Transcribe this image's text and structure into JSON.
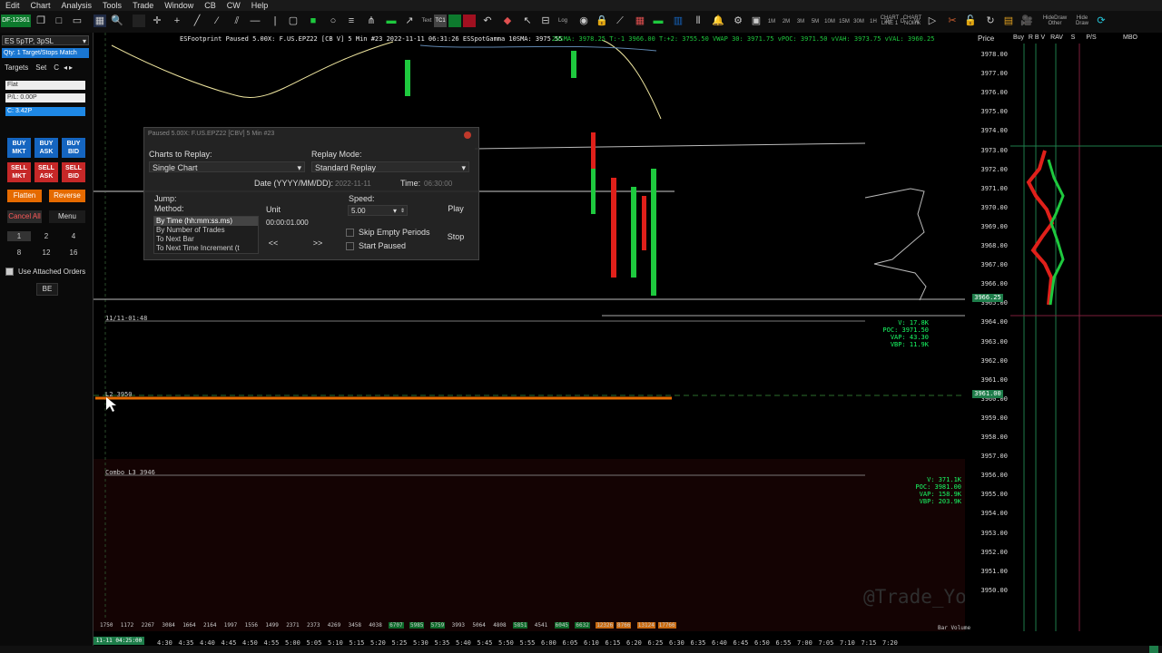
{
  "menu": [
    "Edit",
    "Chart",
    "Analysis",
    "Tools",
    "Trade",
    "Window",
    "CB",
    "CW",
    "Help"
  ],
  "toolbar": {
    "symbol_id": "DF:12361",
    "text_label": "Text",
    "tc_label": "TC1",
    "log_label": "Log",
    "timeframes": [
      "1M",
      "2M",
      "3M",
      "5M",
      "10M",
      "15M",
      "30M",
      "1H",
      "2H",
      "D",
      "W"
    ],
    "chart_line_label": "CHART LINE 1",
    "chart_nolink_label": "CHART NOlink",
    "hide_draw_other": "HideDraw Other",
    "hide_draw": "Hide Draw"
  },
  "trade_panel": {
    "symbol": "ES 5pTP, 3pSL",
    "strategy": "Qty: 1 Target/Stops Match",
    "tabs": [
      "Targets",
      "Set",
      "C"
    ],
    "position": "Flat",
    "pnl": "P/L: 0.00P",
    "closed_pnl": "C: 3.42P",
    "buy_mkt": [
      "BUY",
      "MKT"
    ],
    "buy_ask": [
      "BUY",
      "ASK"
    ],
    "buy_bid": [
      "BUY",
      "BID"
    ],
    "sell_mkt": [
      "SELL",
      "MKT"
    ],
    "sell_ask": [
      "SELL",
      "ASK"
    ],
    "sell_bid": [
      "SELL",
      "BID"
    ],
    "flatten": "Flatten",
    "reverse": "Reverse",
    "cancel_all": "Cancel All",
    "menu": "Menu",
    "quantities": [
      "1",
      "2",
      "4",
      "8",
      "12",
      "16"
    ],
    "attached_orders": "Use Attached Orders",
    "be": "BE"
  },
  "chart": {
    "header": "ESFootprint Paused 5.00X: F.US.EPZ22 [CB V] 5 Min #23 2022-11-11 06:31:26 ESSpotGamma 10SMA: 3975.55",
    "header2": "20SMA: 3978.25 T:-1 3966.00 T:+2: 3755.50 VWAP 30: 3971.75 vPOC: 3971.50 vVAH: 3973.75 vVAL: 3960.25",
    "line_1148": "11/11-01:48",
    "l2_label": "L2 3950",
    "combo_label": "Combo L3 3946",
    "stats_upper": [
      "V: 17.8K",
      "POC: 3971.50",
      "VAP: 43.30",
      "VBP: 11.9K"
    ],
    "stats_lower": [
      "V: 371.1K",
      "POC: 3981.00",
      "VAP: 158.9K",
      "VBP: 203.9K"
    ],
    "watermark": "@Trade_Your_Plan"
  },
  "dialog": {
    "title": "Paused 5.00X: F.US.EPZ22 [CBV] 5 Min #23",
    "charts_label": "Charts to Replay:",
    "charts_value": "Single Chart",
    "mode_label": "Replay Mode:",
    "mode_value": "Standard Replay",
    "date_label": "Date (YYYY/MM/DD):",
    "date_value": "2022-11-11",
    "time_label": "Time:",
    "time_value": "06:30:00",
    "jump_label": "Jump:",
    "method_label": "Method:",
    "methods": [
      "By Time (hh:mm:ss.ms)",
      "By Number of Trades",
      "To Next Bar",
      "To Next Time Increment (t"
    ],
    "unit_label": "Unit",
    "unit_value": "00:00:01.000",
    "prev": "<<",
    "next": ">>",
    "speed_label": "Speed:",
    "speed_value": "5.00",
    "skip_empty": "Skip Empty Periods",
    "start_paused": "Start Paused",
    "play": "Play",
    "stop": "Stop"
  },
  "price_axis": {
    "header": "Price",
    "labels": [
      "3978.00",
      "3977.00",
      "3976.00",
      "3975.00",
      "3974.00",
      "3973.00",
      "3972.00",
      "3971.00",
      "3970.00",
      "3969.00",
      "3968.00",
      "3967.00",
      "3966.00",
      "3965.00",
      "3964.00",
      "3963.00",
      "3962.00",
      "3961.00",
      "3960.00",
      "3959.00",
      "3958.00",
      "3957.00",
      "3956.00",
      "3955.00",
      "3954.00",
      "3953.00",
      "3952.00",
      "3951.00",
      "3950.00"
    ],
    "highlight_1": "3966.25",
    "highlight_2": "3961.00"
  },
  "dom": {
    "headers": [
      "Buy",
      "R B V",
      "RAV",
      "S",
      "P/S",
      "MBO"
    ]
  },
  "time_axis": {
    "labels": [
      "4:30",
      "4:35",
      "4:40",
      "4:45",
      "4:50",
      "4:55",
      "5:00",
      "5:05",
      "5:10",
      "5:15",
      "5:20",
      "5:25",
      "5:30",
      "5:35",
      "5:40",
      "5:45",
      "5:50",
      "5:55",
      "6:00",
      "6:05",
      "6:10",
      "6:15",
      "6:20",
      "6:25",
      "6:30",
      "6:35",
      "6:40",
      "6:45",
      "6:50",
      "6:55",
      "7:00",
      "7:05",
      "7:10",
      "7:15",
      "7:20"
    ],
    "current": "11-11 04:25:00",
    "volumes": [
      "1750",
      "1172",
      "2267",
      "3084",
      "1664",
      "2164",
      "1997",
      "1556",
      "1499",
      "2371",
      "2373",
      "4269",
      "3458",
      "4038",
      "6707",
      "5985",
      "5759",
      "3993",
      "5064",
      "4808",
      "5851",
      "4541",
      "6045",
      "6632",
      "12326",
      "8766",
      "13124",
      "17766"
    ],
    "bar_volume_label": "Bar Volume"
  },
  "colors": {
    "up": "#00c040",
    "down": "#e0201a",
    "accent": "#1565c0",
    "orange": "#e56a00"
  }
}
